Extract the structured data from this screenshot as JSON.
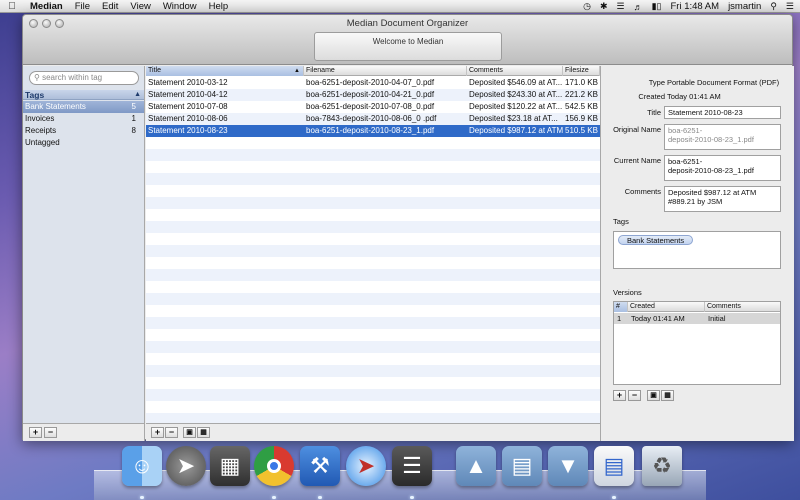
{
  "menubar": {
    "app": "Median",
    "items": [
      "File",
      "Edit",
      "View",
      "Window",
      "Help"
    ],
    "clock": "Fri 1:48 AM",
    "user": "jsmartin"
  },
  "window": {
    "title": "Median Document Organizer",
    "status": "Welcome to Median"
  },
  "sidebar": {
    "search_placeholder": "search within tag",
    "header": "Tags",
    "tags": [
      {
        "name": "Bank Statements",
        "count": "5",
        "selected": true
      },
      {
        "name": "Invoices",
        "count": "1"
      },
      {
        "name": "Receipts",
        "count": "8"
      },
      {
        "name": "Untagged",
        "count": ""
      }
    ],
    "add": "+",
    "remove": "−"
  },
  "table": {
    "columns": [
      "Title",
      "Filename",
      "Comments",
      "Filesize"
    ],
    "rows": [
      {
        "title": "Statement 2010-03-12",
        "filename": "boa-6251-deposit-2010-04-07_0.pdf",
        "comments": "Deposited $546.09 at AT...",
        "size": "171.0 KB"
      },
      {
        "title": "Statement 2010-04-12",
        "filename": "boa-6251-deposit-2010-04-21_0.pdf",
        "comments": "Deposited $243.30 at AT...",
        "size": "221.2 KB"
      },
      {
        "title": "Statement 2010-07-08",
        "filename": "boa-6251-deposit-2010-07-08_0.pdf",
        "comments": "Deposited $120.22 at AT...",
        "size": "542.5 KB"
      },
      {
        "title": "Statement 2010-08-06",
        "filename": "boa-7843-deposit-2010-08-06_0 .pdf",
        "comments": "Deposited $23.18 at AT...",
        "size": "156.9 KB"
      },
      {
        "title": "Statement 2010-08-23",
        "filename": "boa-6251-deposit-2010-08-23_1.pdf",
        "comments": "Deposited $987.12 at ATM",
        "size": "510.5 KB",
        "selected": true
      }
    ],
    "add": "+",
    "remove": "−"
  },
  "details": {
    "type_label": "Type",
    "type_value": "Portable Document Format (PDF)",
    "created_label": "Created",
    "created_value": "Today 01:41 AM",
    "title_label": "Title",
    "title_value": "Statement 2010-08-23",
    "orig_label": "Original Name",
    "orig_line1": "boa-6251-",
    "orig_line2": "deposit-2010-08-23_1.pdf",
    "cur_label": "Current Name",
    "cur_line1": "boa-6251-",
    "cur_line2": "deposit-2010-08-23_1.pdf",
    "comments_label": "Comments",
    "comments_line1": "Deposited $987.12 at ATM",
    "comments_line2": "#889.21 by JSM",
    "tags_label": "Tags",
    "tag_token": "Bank Statements",
    "versions_label": "Versions",
    "versions_cols": [
      "#",
      "Created",
      "Comments"
    ],
    "versions_row": {
      "num": "1",
      "created": "Today 01:41 AM",
      "comments": "Initial"
    },
    "add": "+",
    "remove": "−"
  },
  "dock": [
    "finder",
    "launchpad",
    "photo-browser",
    "chrome",
    "xcode",
    "safari",
    "median",
    "applications",
    "documents",
    "downloads",
    "preview",
    "trash"
  ]
}
